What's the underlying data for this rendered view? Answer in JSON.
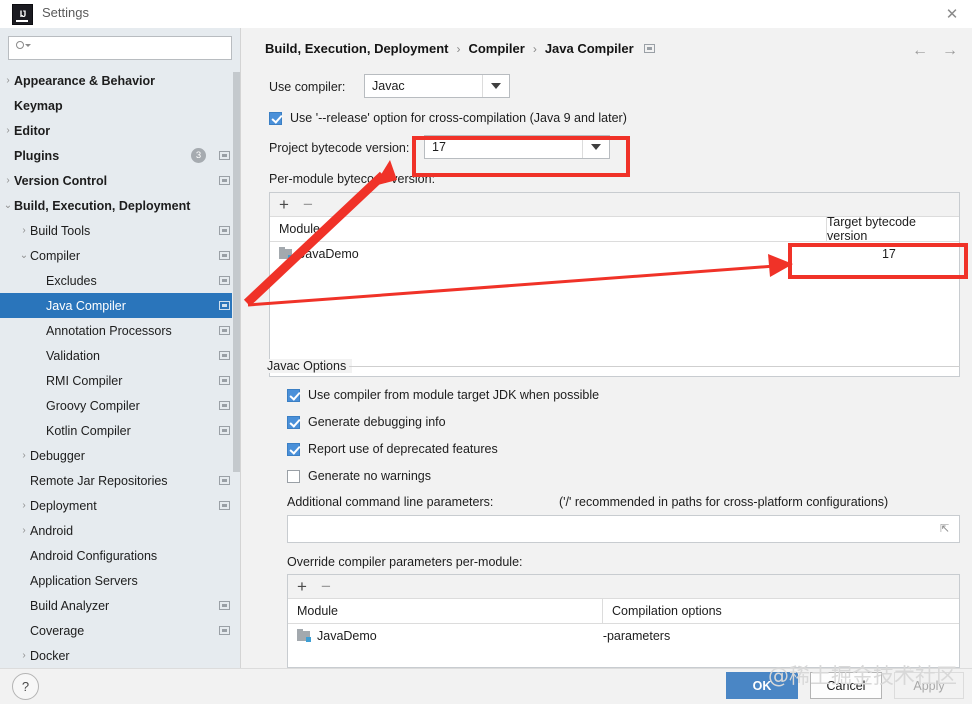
{
  "window": {
    "title": "Settings",
    "logo_text": "IJ",
    "close_icon": "close-icon"
  },
  "search": {
    "value": "",
    "placeholder": ""
  },
  "sidebar": {
    "items": [
      {
        "label": "Appearance & Behavior",
        "indent": 0,
        "bold": true,
        "chevron": "›",
        "screen": false,
        "badge": null,
        "selected": false
      },
      {
        "label": "Keymap",
        "indent": 0,
        "bold": true,
        "chevron": "",
        "screen": false,
        "badge": null,
        "selected": false
      },
      {
        "label": "Editor",
        "indent": 0,
        "bold": true,
        "chevron": "›",
        "screen": false,
        "badge": null,
        "selected": false
      },
      {
        "label": "Plugins",
        "indent": 0,
        "bold": true,
        "chevron": "",
        "screen": true,
        "badge": "3",
        "selected": false
      },
      {
        "label": "Version Control",
        "indent": 0,
        "bold": true,
        "chevron": "›",
        "screen": true,
        "badge": null,
        "selected": false
      },
      {
        "label": "Build, Execution, Deployment",
        "indent": 0,
        "bold": true,
        "chevron": "⌄",
        "screen": false,
        "badge": null,
        "selected": false
      },
      {
        "label": "Build Tools",
        "indent": 1,
        "bold": false,
        "chevron": "›",
        "screen": true,
        "badge": null,
        "selected": false
      },
      {
        "label": "Compiler",
        "indent": 1,
        "bold": false,
        "chevron": "⌄",
        "screen": true,
        "badge": null,
        "selected": false
      },
      {
        "label": "Excludes",
        "indent": 2,
        "bold": false,
        "chevron": "",
        "screen": true,
        "badge": null,
        "selected": false
      },
      {
        "label": "Java Compiler",
        "indent": 2,
        "bold": false,
        "chevron": "",
        "screen": true,
        "badge": null,
        "selected": true
      },
      {
        "label": "Annotation Processors",
        "indent": 2,
        "bold": false,
        "chevron": "",
        "screen": true,
        "badge": null,
        "selected": false
      },
      {
        "label": "Validation",
        "indent": 2,
        "bold": false,
        "chevron": "",
        "screen": true,
        "badge": null,
        "selected": false
      },
      {
        "label": "RMI Compiler",
        "indent": 2,
        "bold": false,
        "chevron": "",
        "screen": true,
        "badge": null,
        "selected": false
      },
      {
        "label": "Groovy Compiler",
        "indent": 2,
        "bold": false,
        "chevron": "",
        "screen": true,
        "badge": null,
        "selected": false
      },
      {
        "label": "Kotlin Compiler",
        "indent": 2,
        "bold": false,
        "chevron": "",
        "screen": true,
        "badge": null,
        "selected": false
      },
      {
        "label": "Debugger",
        "indent": 1,
        "bold": false,
        "chevron": "›",
        "screen": false,
        "badge": null,
        "selected": false
      },
      {
        "label": "Remote Jar Repositories",
        "indent": 1,
        "bold": false,
        "chevron": "",
        "screen": true,
        "badge": null,
        "selected": false
      },
      {
        "label": "Deployment",
        "indent": 1,
        "bold": false,
        "chevron": "›",
        "screen": true,
        "badge": null,
        "selected": false
      },
      {
        "label": "Android",
        "indent": 1,
        "bold": false,
        "chevron": "›",
        "screen": false,
        "badge": null,
        "selected": false
      },
      {
        "label": "Android Configurations",
        "indent": 1,
        "bold": false,
        "chevron": "",
        "screen": false,
        "badge": null,
        "selected": false
      },
      {
        "label": "Application Servers",
        "indent": 1,
        "bold": false,
        "chevron": "",
        "screen": false,
        "badge": null,
        "selected": false
      },
      {
        "label": "Build Analyzer",
        "indent": 1,
        "bold": false,
        "chevron": "",
        "screen": true,
        "badge": null,
        "selected": false
      },
      {
        "label": "Coverage",
        "indent": 1,
        "bold": false,
        "chevron": "",
        "screen": true,
        "badge": null,
        "selected": false
      },
      {
        "label": "Docker",
        "indent": 1,
        "bold": false,
        "chevron": "›",
        "screen": false,
        "badge": null,
        "selected": false
      }
    ]
  },
  "breadcrumb": {
    "part1": "Build, Execution, Deployment",
    "part2": "Compiler",
    "part3": "Java Compiler",
    "separator": "›",
    "back_icon": "arrow-left-icon",
    "forward_icon": "arrow-right-icon"
  },
  "main": {
    "use_compiler_label": "Use compiler:",
    "use_compiler_value": "Javac",
    "release_option_label": "Use '--release' option for cross-compilation (Java 9 and later)",
    "release_option_checked": true,
    "project_bytecode_label": "Project bytecode version:",
    "project_bytecode_value": "17",
    "per_module_label": "Per-module bytecode version:",
    "module_table": {
      "add_label": "+",
      "remove_label": "−",
      "columns": [
        "Module",
        "Target bytecode version"
      ],
      "rows": [
        {
          "module": "JavaDemo",
          "target": "17"
        }
      ]
    },
    "javac_options_title": "Javac Options",
    "javac_checkboxes": [
      {
        "label": "Use compiler from module target JDK when possible",
        "checked": true
      },
      {
        "label": "Generate debugging info",
        "checked": true
      },
      {
        "label": "Report use of deprecated features",
        "checked": true
      },
      {
        "label": "Generate no warnings",
        "checked": false
      }
    ],
    "additional_params_label": "Additional command line parameters:",
    "additional_params_hint": "('/' recommended in paths for cross-platform configurations)",
    "additional_params_value": "",
    "override_label": "Override compiler parameters per-module:",
    "override_table": {
      "add_label": "+",
      "remove_label": "−",
      "columns": [
        "Module",
        "Compilation options"
      ],
      "rows": [
        {
          "module": "JavaDemo",
          "options": "-parameters"
        }
      ]
    }
  },
  "footer": {
    "help_label": "?",
    "ok_label": "OK",
    "cancel_label": "Cancel",
    "apply_label": "Apply"
  },
  "watermark": {
    "text": "@稀土掘金技术社区"
  },
  "annotation": {
    "accent_color": "#f03228"
  }
}
